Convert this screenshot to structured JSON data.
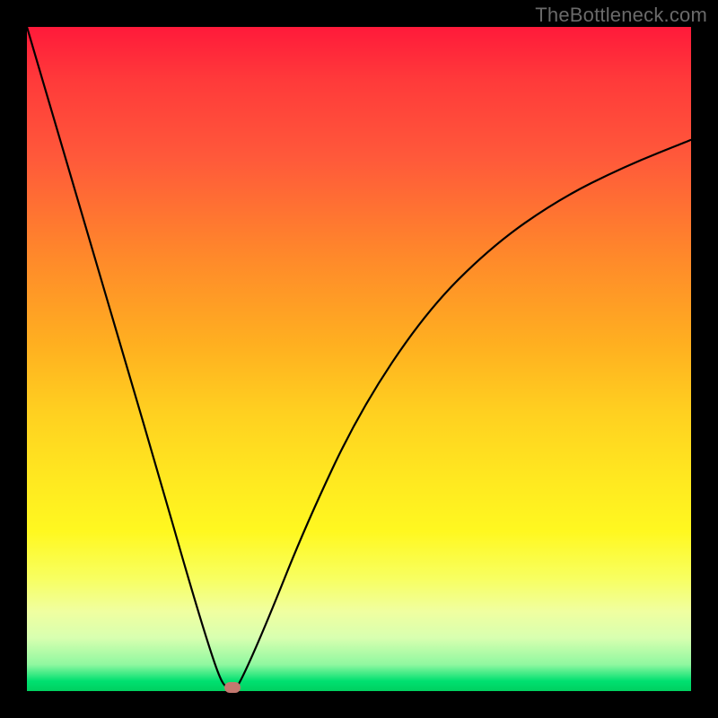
{
  "watermark": "TheBottleneck.com",
  "chart_data": {
    "type": "line",
    "title": "",
    "xlabel": "",
    "ylabel": "",
    "xlim": [
      0,
      100
    ],
    "ylim": [
      0,
      100
    ],
    "series": [
      {
        "name": "bottleneck-curve",
        "x": [
          0,
          5,
          10,
          15,
          20,
          24,
          27,
          29,
          30,
          31,
          32,
          36,
          42,
          50,
          60,
          70,
          80,
          90,
          100
        ],
        "values": [
          100,
          83,
          66,
          49,
          32,
          18,
          8,
          2,
          0.5,
          0,
          1,
          10,
          25,
          42,
          57,
          67,
          74,
          79,
          83
        ]
      }
    ],
    "marker": {
      "x": 31,
      "y": 0.5,
      "color": "#c3786f"
    },
    "background": "rainbow-red-to-green"
  }
}
